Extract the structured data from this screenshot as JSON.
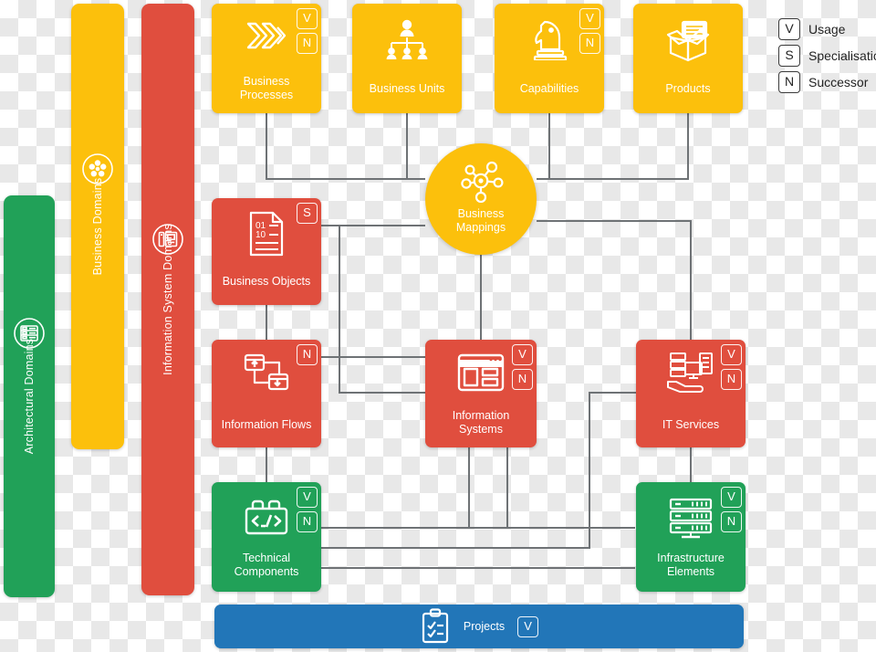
{
  "legend": {
    "items": [
      {
        "key": "V",
        "label": "Usage",
        "name": "legend-usage"
      },
      {
        "key": "S",
        "label": "Specialisation",
        "name": "legend-specialisation"
      },
      {
        "key": "N",
        "label": "Successor",
        "name": "legend-successor"
      }
    ]
  },
  "domain_bars": [
    {
      "id": "architectural-domains",
      "label": "Architectural Domains",
      "color": "#21A158",
      "icon": "server-circle-icon"
    },
    {
      "id": "business-domains",
      "label": "Business Domains",
      "color": "#FCC00C",
      "icon": "flower-circle-icon"
    },
    {
      "id": "information-system-domains",
      "label": "Information System Domains",
      "color": "#E04E3E",
      "icon": "device-circle-icon"
    }
  ],
  "cards": [
    {
      "id": "business-processes",
      "label": "Business Processes",
      "color": "#FCC00C",
      "icon": "chevrons-icon",
      "badges": [
        "V",
        "N"
      ]
    },
    {
      "id": "business-units",
      "label": "Business Units",
      "color": "#FCC00C",
      "icon": "org-chart-icon",
      "badges": []
    },
    {
      "id": "capabilities",
      "label": "Capabilities",
      "color": "#FCC00C",
      "icon": "chess-knight-icon",
      "badges": [
        "V",
        "N"
      ]
    },
    {
      "id": "products",
      "label": "Products",
      "color": "#FCC00C",
      "icon": "open-box-icon",
      "badges": []
    },
    {
      "id": "business-objects",
      "label": "Business Objects",
      "color": "#E04E3E",
      "icon": "binary-document-icon",
      "badges": [
        "S"
      ]
    },
    {
      "id": "information-flows",
      "label": "Information Flows",
      "color": "#E04E3E",
      "icon": "data-exchange-icon",
      "badges": [
        "N"
      ]
    },
    {
      "id": "information-systems",
      "label": "Information Systems",
      "color": "#E04E3E",
      "icon": "app-window-icon",
      "badges": [
        "V",
        "N"
      ]
    },
    {
      "id": "it-services",
      "label": "IT Services",
      "color": "#E04E3E",
      "icon": "hand-server-icon",
      "badges": [
        "V",
        "N"
      ]
    },
    {
      "id": "technical-components",
      "label": "Technical Components",
      "color": "#21A158",
      "icon": "code-brick-icon",
      "badges": [
        "V",
        "N"
      ]
    },
    {
      "id": "infrastructure-elements",
      "label": "Infrastructure Elements",
      "color": "#21A158",
      "icon": "server-rack-icon",
      "badges": [
        "V",
        "N"
      ]
    }
  ],
  "hub": {
    "id": "business-mappings",
    "label_line1": "Business",
    "label_line2": "Mappings",
    "color": "#FCC00C",
    "icon": "network-nodes-icon"
  },
  "projects_bar": {
    "id": "projects",
    "label": "Projects",
    "color": "#2276B8",
    "icon": "clipboard-check-icon",
    "badge": "V"
  },
  "connector_color": "#6E7275"
}
